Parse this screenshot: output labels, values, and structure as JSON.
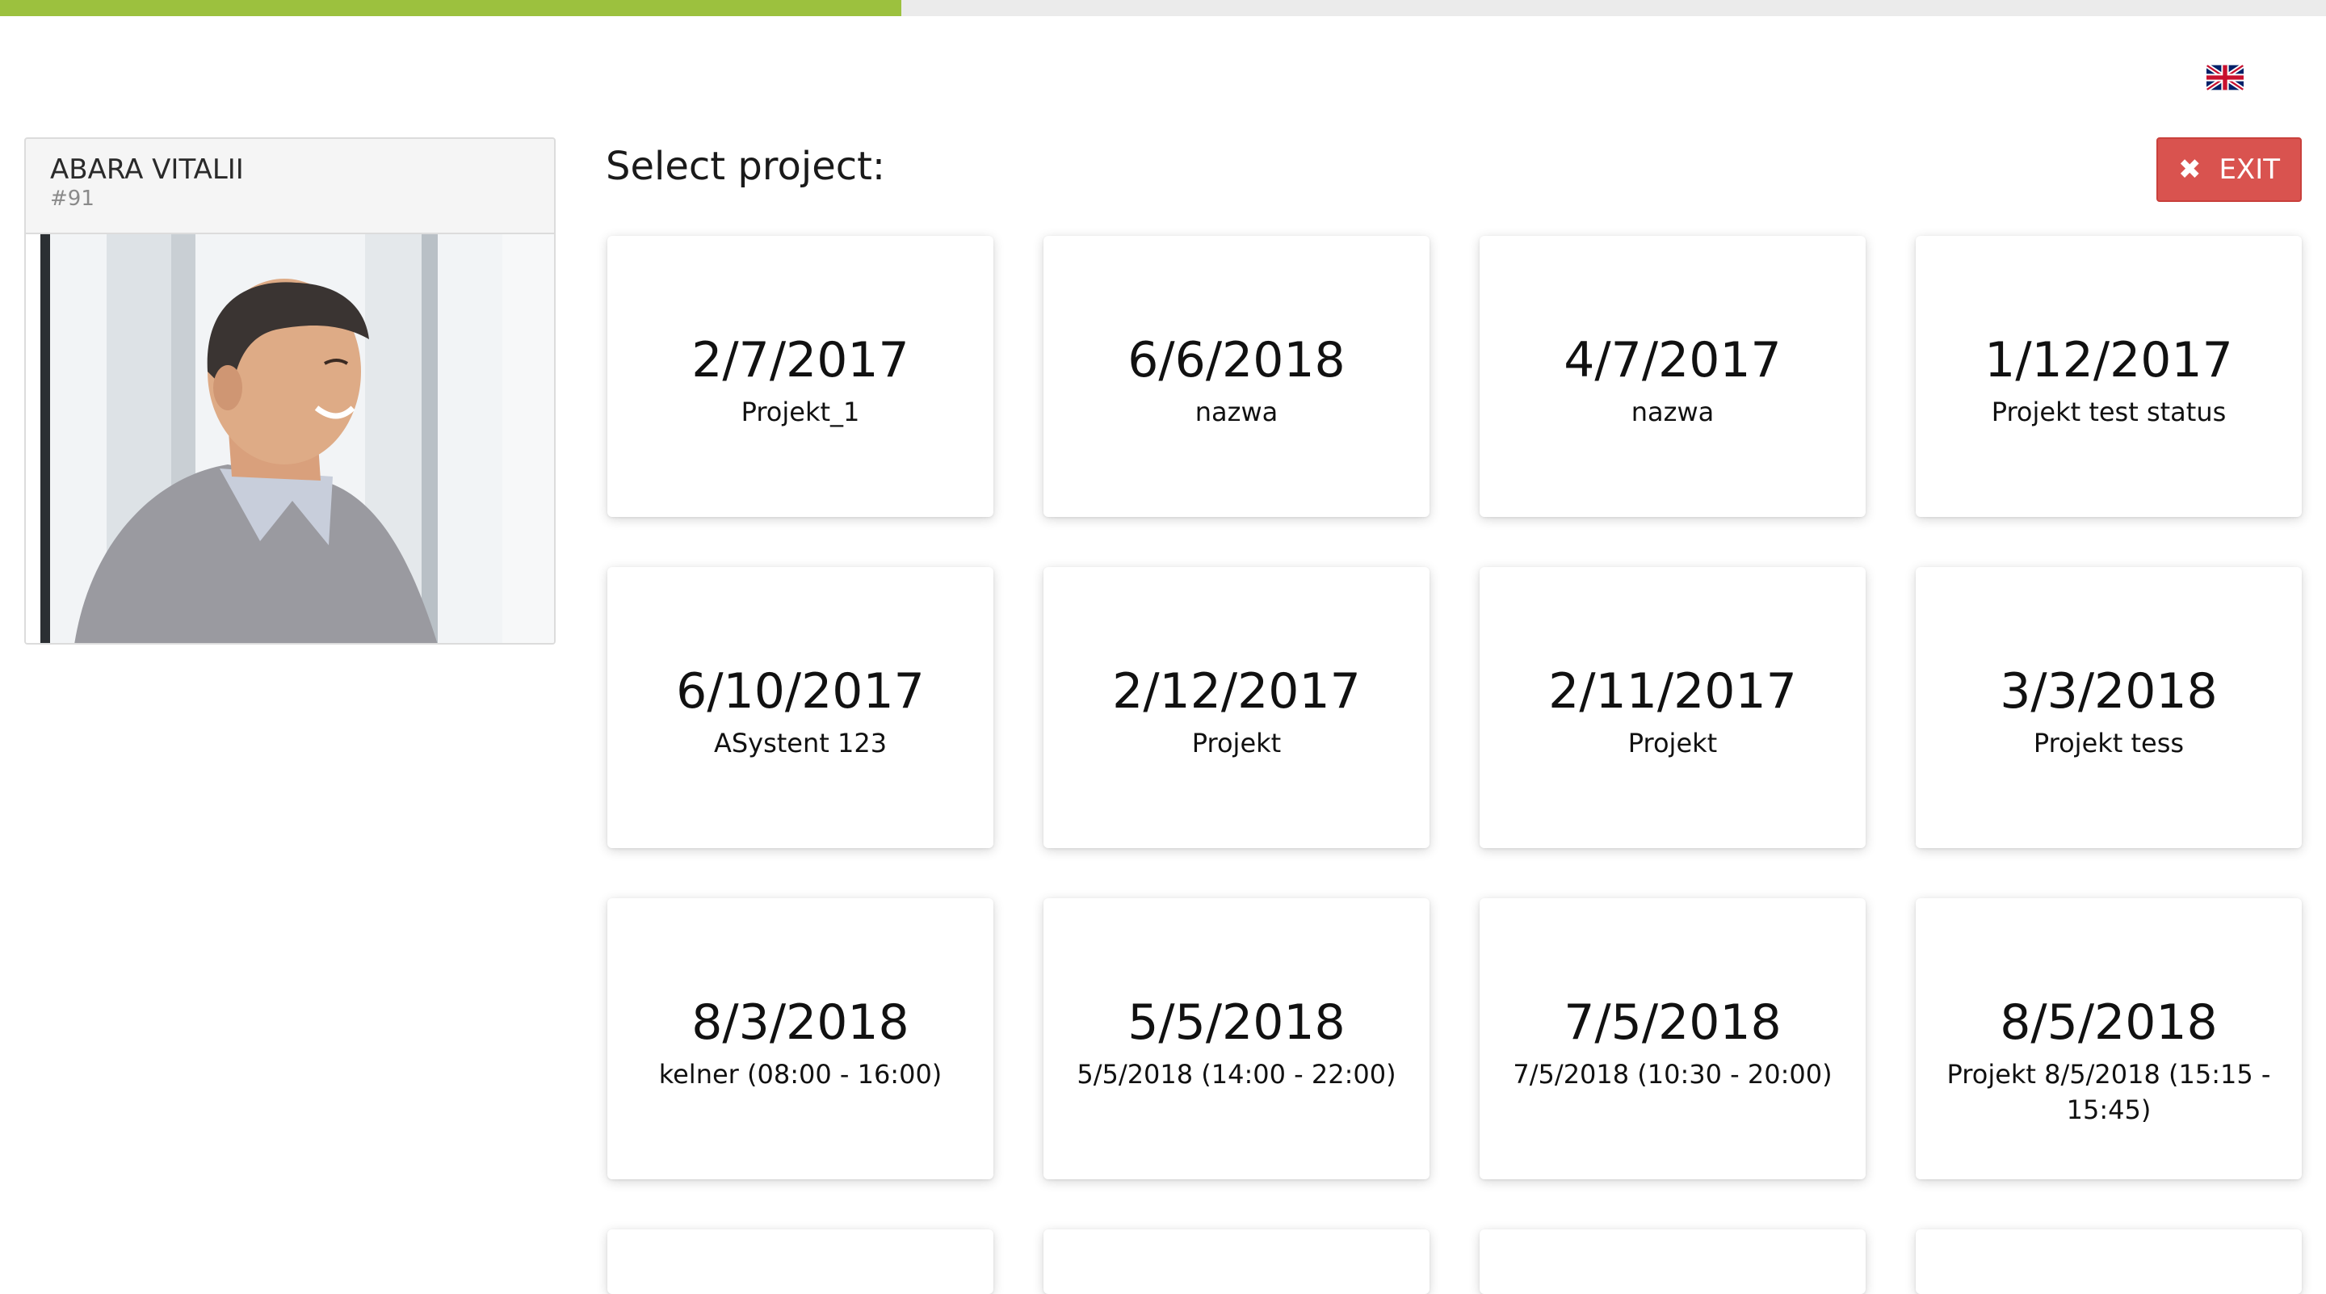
{
  "progress": {
    "fraction": 0.3875,
    "fill_color": "#9cc13e",
    "track_color": "#ebebeb"
  },
  "language": {
    "icon": "uk-flag-icon"
  },
  "profile": {
    "name": "ABARA VITALII",
    "id": "#91"
  },
  "page": {
    "title": "Select project:"
  },
  "exit_button": {
    "label": "EXIT",
    "icon": "close-icon",
    "color": "#d9534f"
  },
  "projects": [
    {
      "date": "2/7/2017",
      "name": "Projekt_1"
    },
    {
      "date": "6/6/2018",
      "name": "nazwa"
    },
    {
      "date": "4/7/2017",
      "name": "nazwa"
    },
    {
      "date": "1/12/2017",
      "name": "Projekt test status"
    },
    {
      "date": "6/10/2017",
      "name": "ASystent 123"
    },
    {
      "date": "2/12/2017",
      "name": "Projekt"
    },
    {
      "date": "2/11/2017",
      "name": "Projekt"
    },
    {
      "date": "3/3/2018",
      "name": "Projekt tess"
    },
    {
      "date": "8/3/2018",
      "name": "kelner (08:00 - 16:00)"
    },
    {
      "date": "5/5/2018",
      "name": "5/5/2018 (14:00 - 22:00)"
    },
    {
      "date": "7/5/2018",
      "name": "7/5/2018 (10:30 - 20:00)"
    },
    {
      "date": "8/5/2018",
      "name": "Projekt 8/5/2018 (15:15 - 15:45)"
    }
  ],
  "partially_visible_cards": 4
}
